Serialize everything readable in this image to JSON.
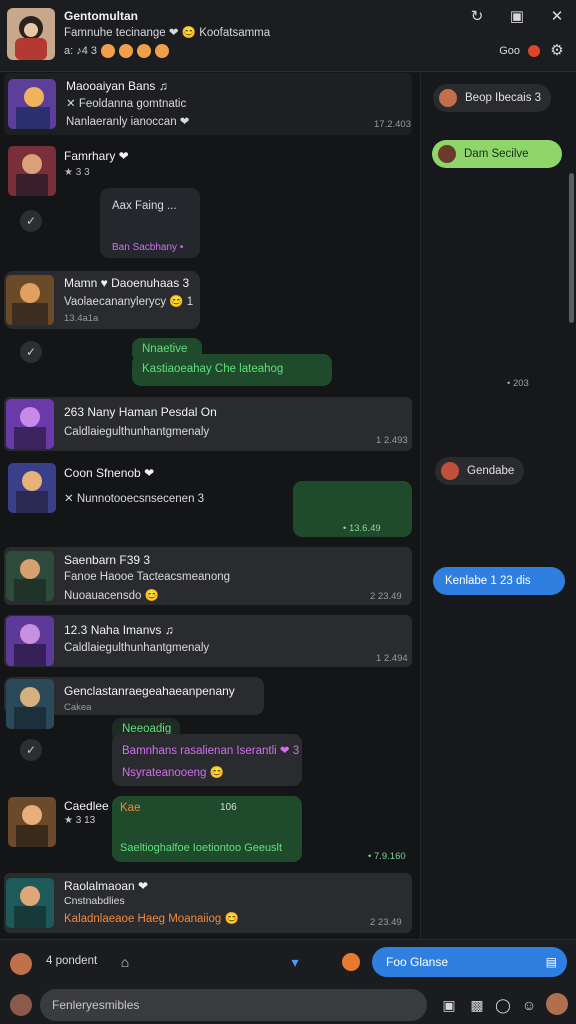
{
  "header": {
    "title": "Gentomultan",
    "subtitle": "Famnuhe tecinange ❤ 😊 Koofatsamma",
    "badges_text": "a: ♪4 3",
    "badge_count": "Goo",
    "icons": [
      "rotate-icon",
      "window-icon",
      "close-icon",
      "settings-icon"
    ]
  },
  "messages": [
    {
      "name": "Maooaiyan Bans ♫",
      "line1": "✕ Feoldanna gomtnatic",
      "line2": "Nanlaeranly ianoccan ❤",
      "time": "17.2.403"
    },
    {
      "name": "Famrhary ❤",
      "sub": "★ 3 3",
      "bubble": "Aax Faing ...",
      "bubble2": "Ban Sacbhany •"
    },
    {
      "name": "Mamn ♥ Daoenuhaas 3",
      "line1": "Vaolaecananylerycy 😊 1",
      "line2": "13.4a1a",
      "reply_title": "Nnaetive",
      "reply_line": "Kastiaoeahay Che lateahog"
    },
    {
      "name": "263 Nany Haman Pesdal On",
      "line1": "Caldlaiegulthunhantgmenaly",
      "time": "1 2.493"
    },
    {
      "name": "Coon Sfnenob ❤",
      "line1": "✕ Nunnotooecsnsecenen 3",
      "bubble_time": "• 13.6.49"
    },
    {
      "name": "Saenbarn F39 3",
      "line1": "Fanoe Haooe Tacteacsmeanong",
      "line2": "Nuoauacensdo 😊",
      "time": "2 23.49"
    },
    {
      "name": "12.3 Naha Imanvs ♫",
      "line1": "Caldlaiegulthunhantgmenaly",
      "time": "1 2.494"
    },
    {
      "name": "Genclastanraegeahaeanpenany",
      "sub": "Cakea",
      "reply_title": "Neeoadig",
      "reply_line": "Bamnhans rasalienan Iserantli ❤ 3",
      "reply_line2": "Nsyrateanooeng 😊"
    },
    {
      "name": "Caedlee",
      "sub": "★ 3 13",
      "bubble_title": "Kae",
      "bubble_meta": "106",
      "bubble_line": "Saeltioghalfoe Ioetiontoo Geeuslt",
      "time": "• 7.9.160"
    },
    {
      "name": "Raolalmaoan ❤",
      "line1": "Cnstnabdlies",
      "line2": "Kaladnlaeaoe Haeg Moanaiiog 😊",
      "time": "2 23.49"
    }
  ],
  "panel": {
    "pill1": "Beop Ibecais 3",
    "pill2": "Dam Secilve",
    "timestamp": "• 203",
    "pill3": "Gendabe",
    "pill4": "Kenlabe 1 23 dis"
  },
  "bottom": {
    "status_text": "4 pondent",
    "send_label": "Foo Glanse",
    "compose_placeholder": "Fenleryesmibles"
  },
  "colors": {
    "accent_blue": "#2f7fe0",
    "accent_green": "#5fe07d",
    "bubble_green": "#1f4a2b",
    "purple_text": "#d26ef2"
  }
}
